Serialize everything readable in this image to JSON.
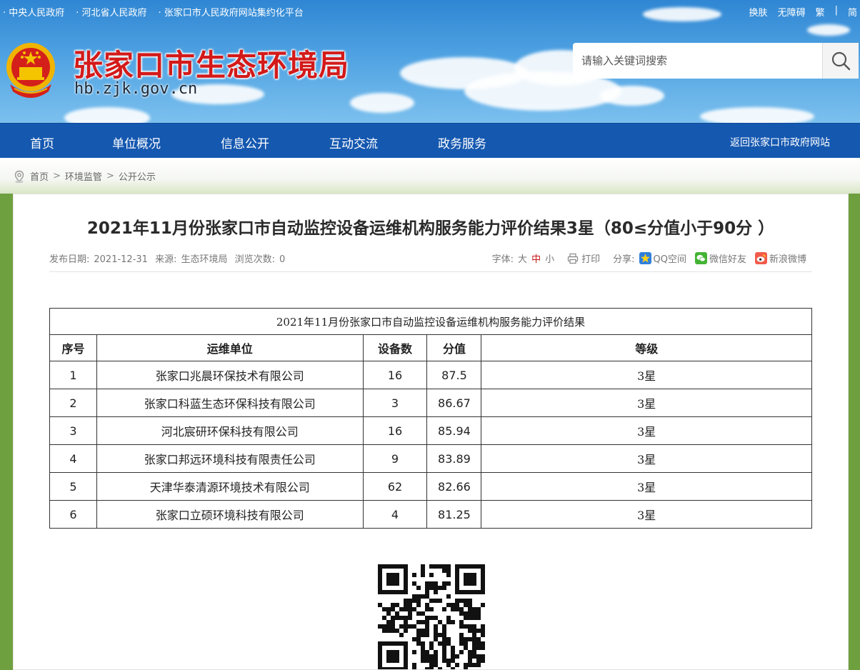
{
  "top_links": [
    "· 中央人民政府",
    "· 河北省人民政府",
    "· 张家口市人民政府网站集约化平台"
  ],
  "top_right": [
    "换肤",
    "无障碍",
    "繁",
    "简"
  ],
  "top_right_sep": "|",
  "site": {
    "title": "张家口市生态环境局",
    "domain": "hb.zjk.gov.cn"
  },
  "search": {
    "placeholder": "请输入关键词搜索"
  },
  "nav": {
    "items": [
      "首页",
      "单位概况",
      "信息公开",
      "互动交流",
      "政务服务"
    ],
    "return_label": "返回张家口市政府网站"
  },
  "breadcrumb": {
    "items": [
      "首页",
      "环境监管",
      "公开公示"
    ],
    "sep": ">"
  },
  "article": {
    "title": "2021年11月份张家口市自动监控设备运维机构服务能力评价结果3星（80≤分值小于90分 ）",
    "publish_label": "发布日期:",
    "publish_date": "2021-12-31",
    "source_label": "来源:",
    "source": "生态环境局",
    "views_label": "浏览次数:",
    "views": "0",
    "font_label": "字体:",
    "font_large": "大",
    "font_medium": "中",
    "font_small": "小",
    "print_label": "打印",
    "share_label": "分享:",
    "share_qq": "QQ空间",
    "share_wechat": "微信好友",
    "share_weibo": "新浪微博"
  },
  "table": {
    "caption": "2021年11月份张家口市自动监控设备运维机构服务能力评价结果",
    "headers": [
      "序号",
      "运维单位",
      "设备数",
      "分值",
      "等级"
    ],
    "rows": [
      [
        "1",
        "张家口兆晨环保技术有限公司",
        "16",
        "87.5",
        "3星"
      ],
      [
        "2",
        "张家口科蓝生态环保科技有限公司",
        "3",
        "86.67",
        "3星"
      ],
      [
        "3",
        "河北宸研环保科技有限公司",
        "16",
        "85.94",
        "3星"
      ],
      [
        "4",
        "张家口邦远环境科技有限责任公司",
        "9",
        "83.89",
        "3星"
      ],
      [
        "5",
        "天津华泰清源环境技术有限公司",
        "62",
        "82.66",
        "3星"
      ],
      [
        "6",
        "张家口立硕环境科技有限公司",
        "4",
        "81.25",
        "3星"
      ]
    ]
  },
  "colors": {
    "nav_bg": "#1558b0",
    "title_red": "#d31a1a",
    "font_medium_red": "#c81616"
  },
  "icons": [
    "location-pin-icon",
    "search-icon",
    "print-icon",
    "qq-zone-icon",
    "wechat-icon",
    "weibo-icon",
    "national-emblem",
    "qr-code"
  ]
}
